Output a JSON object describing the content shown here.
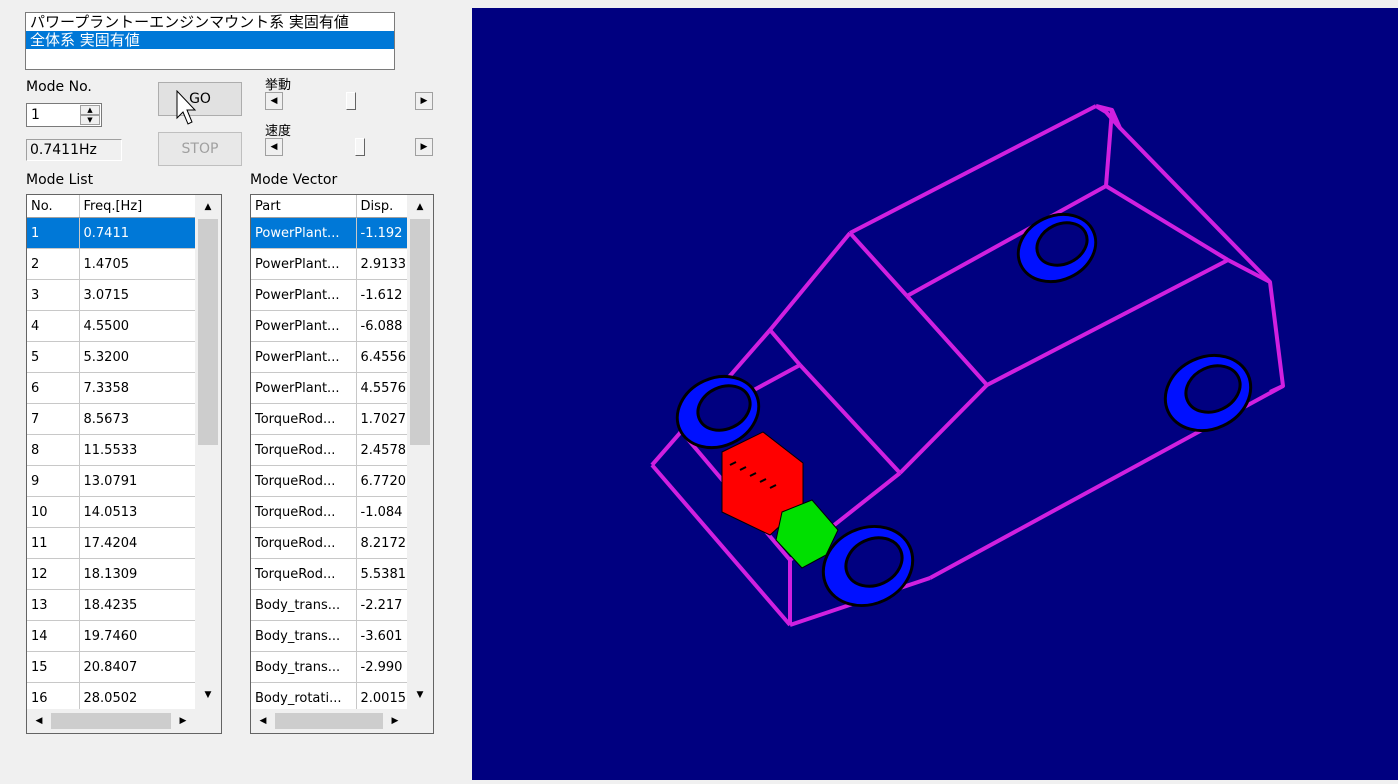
{
  "model_list": {
    "items": [
      "パワープラントーエンジンマウント系 実固有値",
      "全体系 実固有値"
    ],
    "selected_index": 1
  },
  "mode_no": {
    "label": "Mode No.",
    "value": "1"
  },
  "frequency_display": "0.7411Hz",
  "buttons": {
    "go": "GO",
    "stop": "STOP"
  },
  "sliders": {
    "motion": {
      "label": "挙動",
      "value_percent": 52
    },
    "speed": {
      "label": "速度",
      "value_percent": 59
    }
  },
  "mode_list": {
    "title": "Mode List",
    "columns": [
      "No.",
      "Freq.[Hz]"
    ],
    "rows": [
      [
        "1",
        "0.7411"
      ],
      [
        "2",
        "1.4705"
      ],
      [
        "3",
        "3.0715"
      ],
      [
        "4",
        "4.5500"
      ],
      [
        "5",
        "5.3200"
      ],
      [
        "6",
        "7.3358"
      ],
      [
        "7",
        "8.5673"
      ],
      [
        "8",
        "11.5533"
      ],
      [
        "9",
        "13.0791"
      ],
      [
        "10",
        "14.0513"
      ],
      [
        "11",
        "17.4204"
      ],
      [
        "12",
        "18.1309"
      ],
      [
        "13",
        "18.4235"
      ],
      [
        "14",
        "19.7460"
      ],
      [
        "15",
        "20.8407"
      ],
      [
        "16",
        "28.0502"
      ]
    ],
    "selected_index": 0
  },
  "mode_vector": {
    "title": "Mode Vector",
    "columns": [
      "Part",
      "Disp."
    ],
    "rows": [
      [
        "PowerPlant...",
        "-1.192"
      ],
      [
        "PowerPlant...",
        "2.9133"
      ],
      [
        "PowerPlant...",
        "-1.612"
      ],
      [
        "PowerPlant...",
        "-6.088"
      ],
      [
        "PowerPlant...",
        "6.4556"
      ],
      [
        "PowerPlant...",
        "4.5576"
      ],
      [
        "TorqueRod...",
        "1.7027"
      ],
      [
        "TorqueRod...",
        "2.4578"
      ],
      [
        "TorqueRod...",
        "6.7720"
      ],
      [
        "TorqueRod...",
        "-1.084"
      ],
      [
        "TorqueRod...",
        "8.2172"
      ],
      [
        "TorqueRod...",
        "5.5381"
      ],
      [
        "Body_trans...",
        "-2.217"
      ],
      [
        "Body_trans...",
        "-3.601"
      ],
      [
        "Body_trans...",
        "-2.990"
      ],
      [
        "Body_rotati...",
        "2.0015"
      ]
    ],
    "selected_index": 0
  },
  "colors": {
    "viewport_bg": "#000080",
    "frame": "#d020e0",
    "wheel": "#0010ff",
    "engine": "#ff0000",
    "mount": "#00e000",
    "selection": "#0078d7"
  }
}
